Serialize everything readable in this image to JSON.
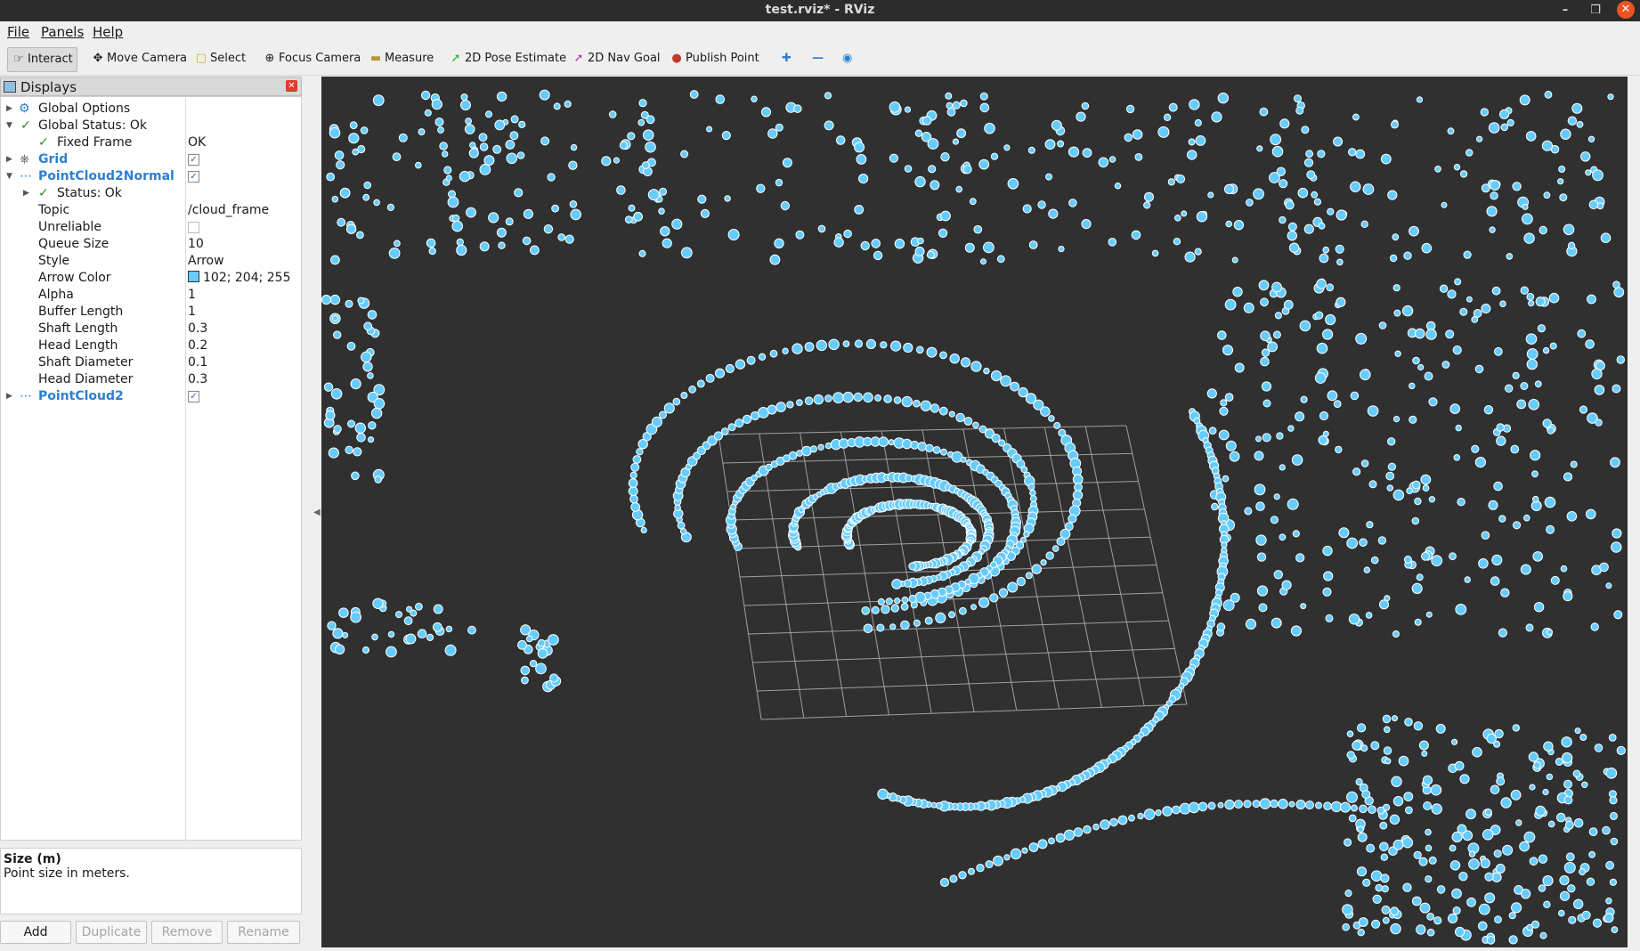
{
  "window": {
    "title": "test.rviz* - RViz"
  },
  "menu": [
    "File",
    "Panels",
    "Help"
  ],
  "toolbar": {
    "interact": "Interact",
    "move_camera": "Move Camera",
    "select": "Select",
    "focus_camera": "Focus Camera",
    "measure": "Measure",
    "pose_estimate": "2D Pose Estimate",
    "nav_goal": "2D Nav Goal",
    "publish_point": "Publish Point"
  },
  "displays": {
    "title": "Displays",
    "global_options": "Global Options",
    "global_status": "Global Status: Ok",
    "fixed_frame_label": "Fixed Frame",
    "fixed_frame_value": "OK",
    "grid": "Grid",
    "pc2normal": "PointCloud2Normal",
    "status": "Status: Ok",
    "props": [
      {
        "label": "Topic",
        "value": "/cloud_frame"
      },
      {
        "label": "Unreliable",
        "value": ""
      },
      {
        "label": "Queue Size",
        "value": "10"
      },
      {
        "label": "Style",
        "value": "Arrow"
      },
      {
        "label": "Arrow Color",
        "value": "102; 204; 255"
      },
      {
        "label": "Alpha",
        "value": "1"
      },
      {
        "label": "Buffer Length",
        "value": "1"
      },
      {
        "label": "Shaft Length",
        "value": "0.3"
      },
      {
        "label": "Head Length",
        "value": "0.2"
      },
      {
        "label": "Shaft Diameter",
        "value": "0.1"
      },
      {
        "label": "Head Diameter",
        "value": "0.3"
      }
    ],
    "pc2": "PointCloud2"
  },
  "help": {
    "title": "Size (m)",
    "text": "Point size in meters."
  },
  "buttons": {
    "add": "Add",
    "duplicate": "Duplicate",
    "remove": "Remove",
    "rename": "Rename"
  },
  "colors": {
    "arrow": "#66ccff",
    "background": "#303030",
    "grid": "#a0a0a0"
  }
}
